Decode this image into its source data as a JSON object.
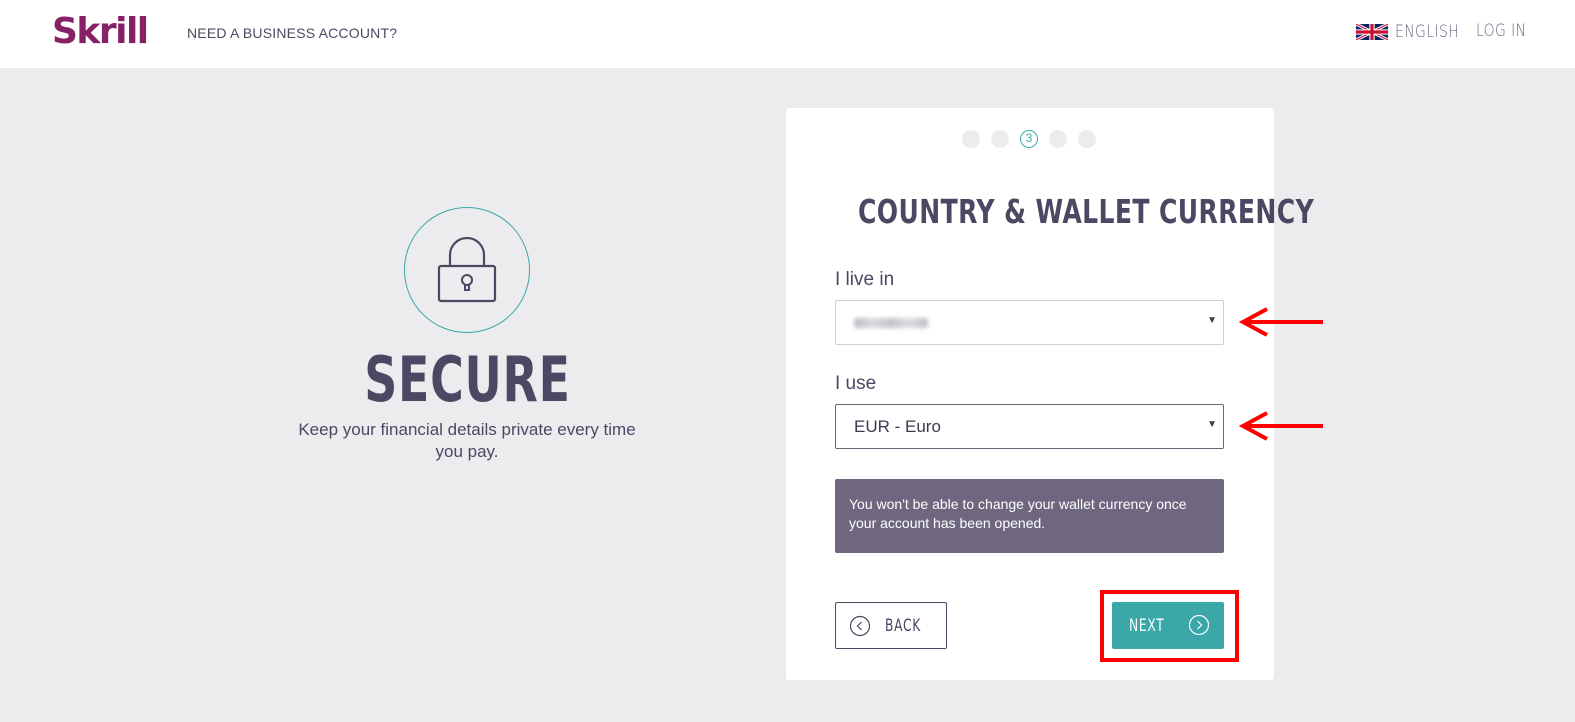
{
  "header": {
    "logo": "Skrill",
    "business_link": "NEED A BUSINESS ACCOUNT?",
    "language": "ENGLISH",
    "login": "LOG IN"
  },
  "promo": {
    "icon": "lock-icon",
    "title": "SECURE",
    "text": "Keep your financial details private every time you pay."
  },
  "card": {
    "steps": [
      "",
      "",
      "3",
      "",
      ""
    ],
    "active_step": 3,
    "title": "COUNTRY & WALLET CURRENCY",
    "country_label": "I live in",
    "country_value": "",
    "currency_label": "I use",
    "currency_value": "EUR - Euro",
    "notice": "You won't be able to change your wallet currency once your account has been opened.",
    "back_label": "BACK",
    "next_label": "NEXT"
  },
  "colors": {
    "brand": "#862165",
    "accent": "#3aa7a9",
    "text": "#4e4763",
    "notice_bg": "#6e677f",
    "annotation": "#ff0000"
  }
}
